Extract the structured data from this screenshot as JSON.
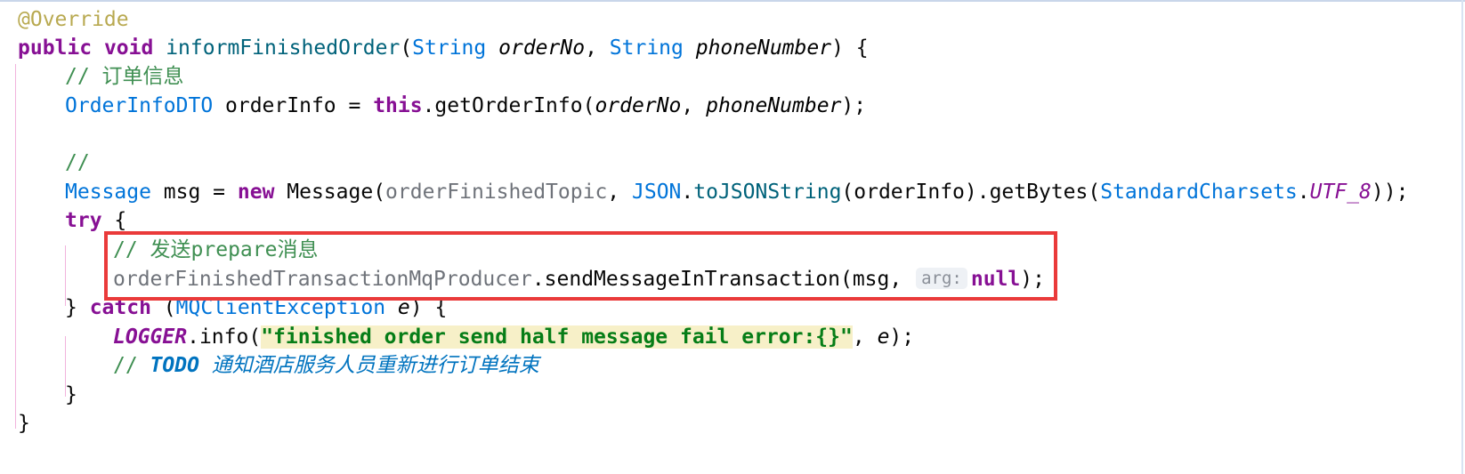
{
  "editor": {
    "lines": {
      "l1": {
        "annotation": "@Override"
      },
      "l2": {
        "kw_public": "public",
        "kw_void": "void",
        "method_name": "informFinishedOrder",
        "paren_open": "(",
        "type_string1": "String",
        "param1": "orderNo",
        "comma": ",",
        "type_string2": "String",
        "param2": "phoneNumber",
        "tail": ") {"
      },
      "l3": {
        "comment": "// 订单信息"
      },
      "l4": {
        "type": "OrderInfoDTO",
        "var": " orderInfo = ",
        "kw_this": "this",
        "call": ".getOrderInfo(",
        "arg1": "orderNo",
        "sep": ", ",
        "arg2": "phoneNumber",
        "tail": ");"
      },
      "l5": {
        "comment": "//"
      },
      "l6": {
        "type": "Message",
        "var": " msg = ",
        "kw_new": "new",
        "ctor": " Message(",
        "field": "orderFinishedTopic",
        "sep": ", ",
        "type_json": "JSON",
        "dot": ".",
        "method": "toJSONString",
        "mid": "(orderInfo).getBytes(",
        "type_charsets": "StandardCharsets",
        "dot2": ".",
        "static_field": "UTF_8",
        "tail": "));"
      },
      "l7": {
        "kw_try": "try",
        "brace": " {"
      },
      "l8": {
        "comment": "// 发送prepare消息"
      },
      "l9": {
        "receiver": "orderFinishedTransactionMqProducer",
        "call": ".sendMessageInTransaction(msg, ",
        "hint": "arg:",
        "kw_null": "null",
        "tail": ");"
      },
      "l10": {
        "brace": "} ",
        "kw_catch": "catch",
        "open": " (",
        "type": "MQClientException",
        "param": " e",
        "tail": ") {"
      },
      "l11": {
        "logger": "LOGGER",
        "call": ".info(",
        "string": "\"finished order send half message fail error:{}\"",
        "sep": ", ",
        "param": "e",
        "tail": ");"
      },
      "l12": {
        "slashes": "// ",
        "todo": "TODO",
        "text": " 通知酒店服务人员重新进行订单结束"
      },
      "l13": {
        "brace": "}"
      },
      "l14": {
        "brace": "}"
      }
    }
  },
  "colors": {
    "keyword": "#0033b3",
    "type": "#0074d9",
    "comment": "#3f8f52",
    "string": "#067d17",
    "highlight_box": "#ea3a3a"
  }
}
